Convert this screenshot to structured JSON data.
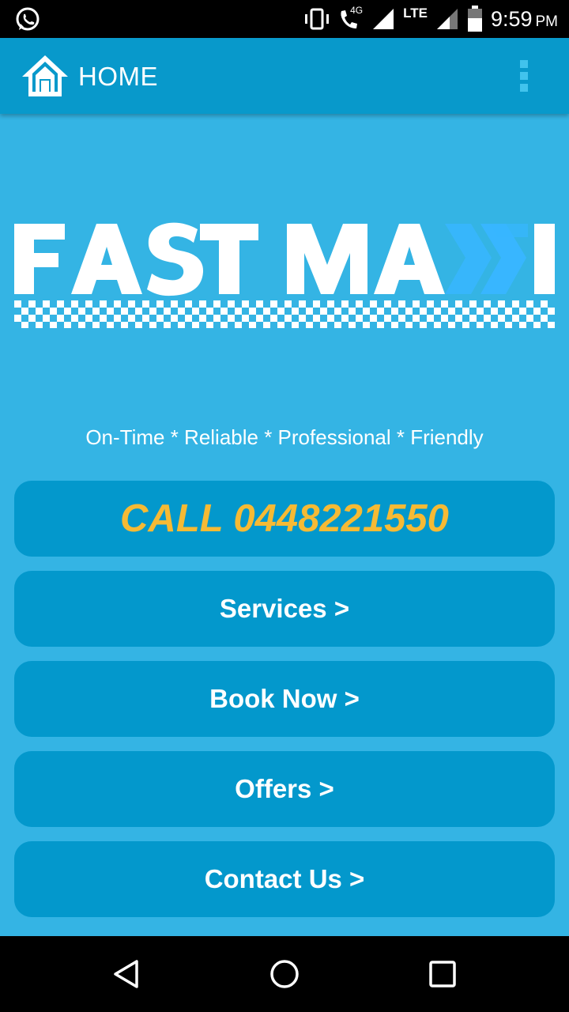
{
  "status_bar": {
    "network_tag": "4G",
    "network": "LTE",
    "time": "9:59",
    "ampm": "PM",
    "icons": [
      "whatsapp-icon",
      "vibrate-icon",
      "volte-call-icon",
      "signal-icon",
      "battery-icon"
    ]
  },
  "app_bar": {
    "title": "HOME",
    "icons": [
      "home-icon",
      "overflow-menu-icon"
    ]
  },
  "logo": {
    "text": "FAST MAXI",
    "colors": {
      "text": "#ffffff",
      "accent": "#38b6ff"
    }
  },
  "tagline": "On-Time * Reliable * Professional * Friendly",
  "menu": {
    "call_label": "CALL 0448221550",
    "services_label": "Services >",
    "book_label": "Book Now >",
    "offers_label": "Offers >",
    "contact_label": "Contact Us >"
  },
  "nav_bar": {
    "icons": [
      "back-icon",
      "home-circle-icon",
      "recents-icon"
    ]
  },
  "colors": {
    "background": "#34b4e4",
    "app_bar": "#0899cb",
    "button": "#0398cc",
    "call_text": "#f6ba34"
  }
}
